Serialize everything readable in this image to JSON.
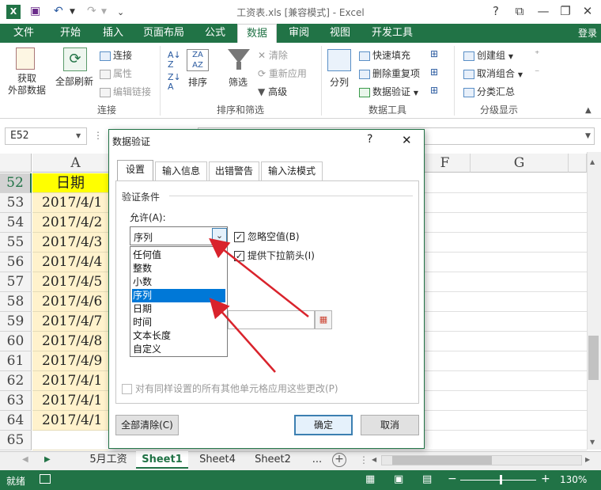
{
  "window": {
    "title": "工资表.xls  [兼容模式] - Excel",
    "signin": "登录"
  },
  "ribbon_tabs": [
    "文件",
    "开始",
    "插入",
    "页面布局",
    "公式",
    "数据",
    "审阅",
    "视图",
    "开发工具"
  ],
  "active_tab_index": 5,
  "ribbon": {
    "get_external": "获取\n外部数据",
    "refresh_all": "全部刷新",
    "connections": "连接",
    "properties": "属性",
    "edit_links": "编辑链接",
    "group_connections": "连接",
    "sort": "排序",
    "filter": "筛选",
    "clear": "清除",
    "reapply": "重新应用",
    "advanced": "高级",
    "group_sort_filter": "排序和筛选",
    "split": "分列",
    "flash_fill": "快速填充",
    "remove_dup": "删除重复项",
    "data_validation": "数据验证",
    "group_data_tools": "数据工具",
    "group": "创建组",
    "ungroup": "取消组合",
    "subtotal": "分类汇总",
    "group_outline": "分级显示"
  },
  "name_box": "E52",
  "columns": [
    "A",
    "F",
    "G"
  ],
  "rows": [
    {
      "num": "52",
      "a": "日期"
    },
    {
      "num": "53",
      "a": "2017/4/1"
    },
    {
      "num": "54",
      "a": "2017/4/2"
    },
    {
      "num": "55",
      "a": "2017/4/3"
    },
    {
      "num": "56",
      "a": "2017/4/4"
    },
    {
      "num": "57",
      "a": "2017/4/5"
    },
    {
      "num": "58",
      "a": "2017/4/6"
    },
    {
      "num": "59",
      "a": "2017/4/7"
    },
    {
      "num": "60",
      "a": "2017/4/8"
    },
    {
      "num": "61",
      "a": "2017/4/9"
    },
    {
      "num": "62",
      "a": "2017/4/1"
    },
    {
      "num": "63",
      "a": "2017/4/1"
    },
    {
      "num": "64",
      "a": "2017/4/1"
    },
    {
      "num": "65",
      "a": ""
    }
  ],
  "sheet_tabs": [
    "5月工资",
    "Sheet1",
    "Sheet4",
    "Sheet2",
    "..."
  ],
  "active_sheet_index": 1,
  "status": {
    "ready": "就绪",
    "zoom": "130%"
  },
  "dialog": {
    "title": "数据验证",
    "help": "?",
    "close": "✕",
    "tabs": [
      "设置",
      "输入信息",
      "出错警告",
      "输入法模式"
    ],
    "section": "验证条件",
    "allow_label": "允许(A):",
    "allow_value": "序列",
    "ignore_blank": "忽略空值(B)",
    "dropdown": "提供下拉箭头(I)",
    "options": [
      "任何值",
      "整数",
      "小数",
      "序列",
      "日期",
      "时间",
      "文本长度",
      "自定义"
    ],
    "selected_option": 3,
    "apply_all": "对有同样设置的所有其他单元格应用这些更改(P)",
    "clear_all": "全部清除(C)",
    "ok": "确定",
    "cancel": "取消"
  },
  "colors": {
    "excel_green": "#217346",
    "highlight": "#0078d7",
    "arrow": "#d9232c",
    "cell_fill": "#fff2cc"
  }
}
